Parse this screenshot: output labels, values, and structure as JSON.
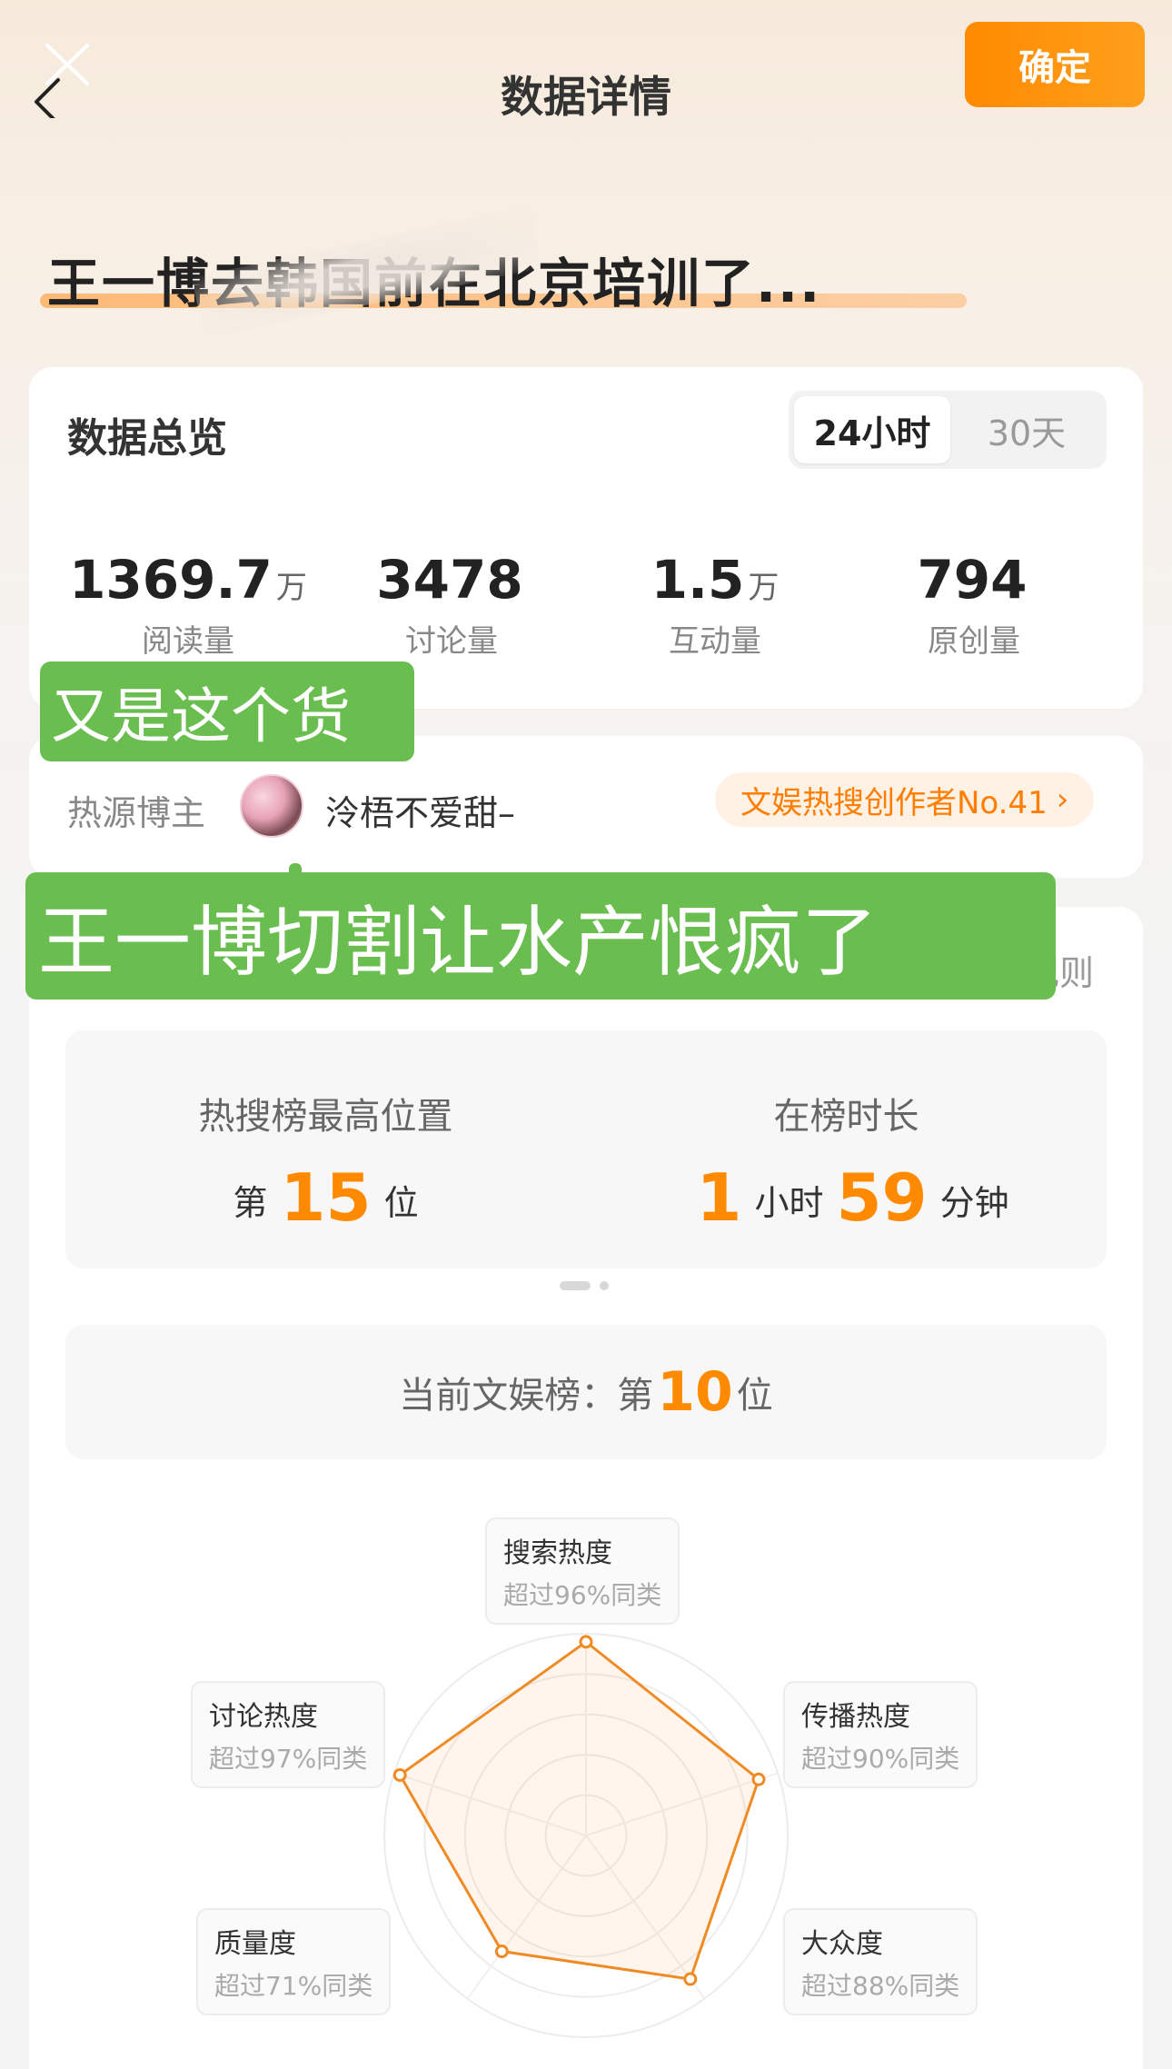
{
  "header": {
    "title": "数据详情",
    "confirm_label": "确定"
  },
  "topic": {
    "title": "王一博去韩国前在北京培训了..."
  },
  "overview": {
    "heading": "数据总览",
    "tabs": [
      "24小时",
      "30天"
    ],
    "active_tab": "24小时",
    "stats": [
      {
        "value": "1369.7",
        "unit": "万",
        "label": "阅读量"
      },
      {
        "value": "3478",
        "unit": "",
        "label": "讨论量"
      },
      {
        "value": "1.5",
        "unit": "万",
        "label": "互动量"
      },
      {
        "value": "794",
        "unit": "",
        "label": "原创量"
      }
    ]
  },
  "source": {
    "label": "热源博主",
    "username": "泠梧不爱甜–",
    "rank_badge": "文娱热搜创作者No.41"
  },
  "detail": {
    "rules_label": "规则",
    "peak": {
      "title": "热搜榜最高位置",
      "prefix": "第",
      "value": "15",
      "suffix": "位"
    },
    "duration": {
      "title": "在榜时长",
      "hours": "1",
      "hours_unit": "小时",
      "minutes": "59",
      "minutes_unit": "分钟"
    },
    "current": {
      "label": "当前文娱榜：第",
      "value": "10",
      "suffix": "位"
    }
  },
  "radar": {
    "accent_color": "#f08a24",
    "metrics": [
      {
        "name": "搜索热度",
        "sub": "超过96%同类",
        "percent": 96
      },
      {
        "name": "传播热度",
        "sub": "超过90%同类",
        "percent": 90
      },
      {
        "name": "大众度",
        "sub": "超过88%同类",
        "percent": 88
      },
      {
        "name": "质量度",
        "sub": "超过71%同类",
        "percent": 71
      },
      {
        "name": "讨论热度",
        "sub": "超过97%同类",
        "percent": 97
      }
    ]
  },
  "stickers": {
    "top": "又是这个货",
    "main": "王一博切割让水产恨疯了"
  },
  "colors": {
    "accent": "#ff8a00",
    "sticker_green": "#6abd4f"
  }
}
